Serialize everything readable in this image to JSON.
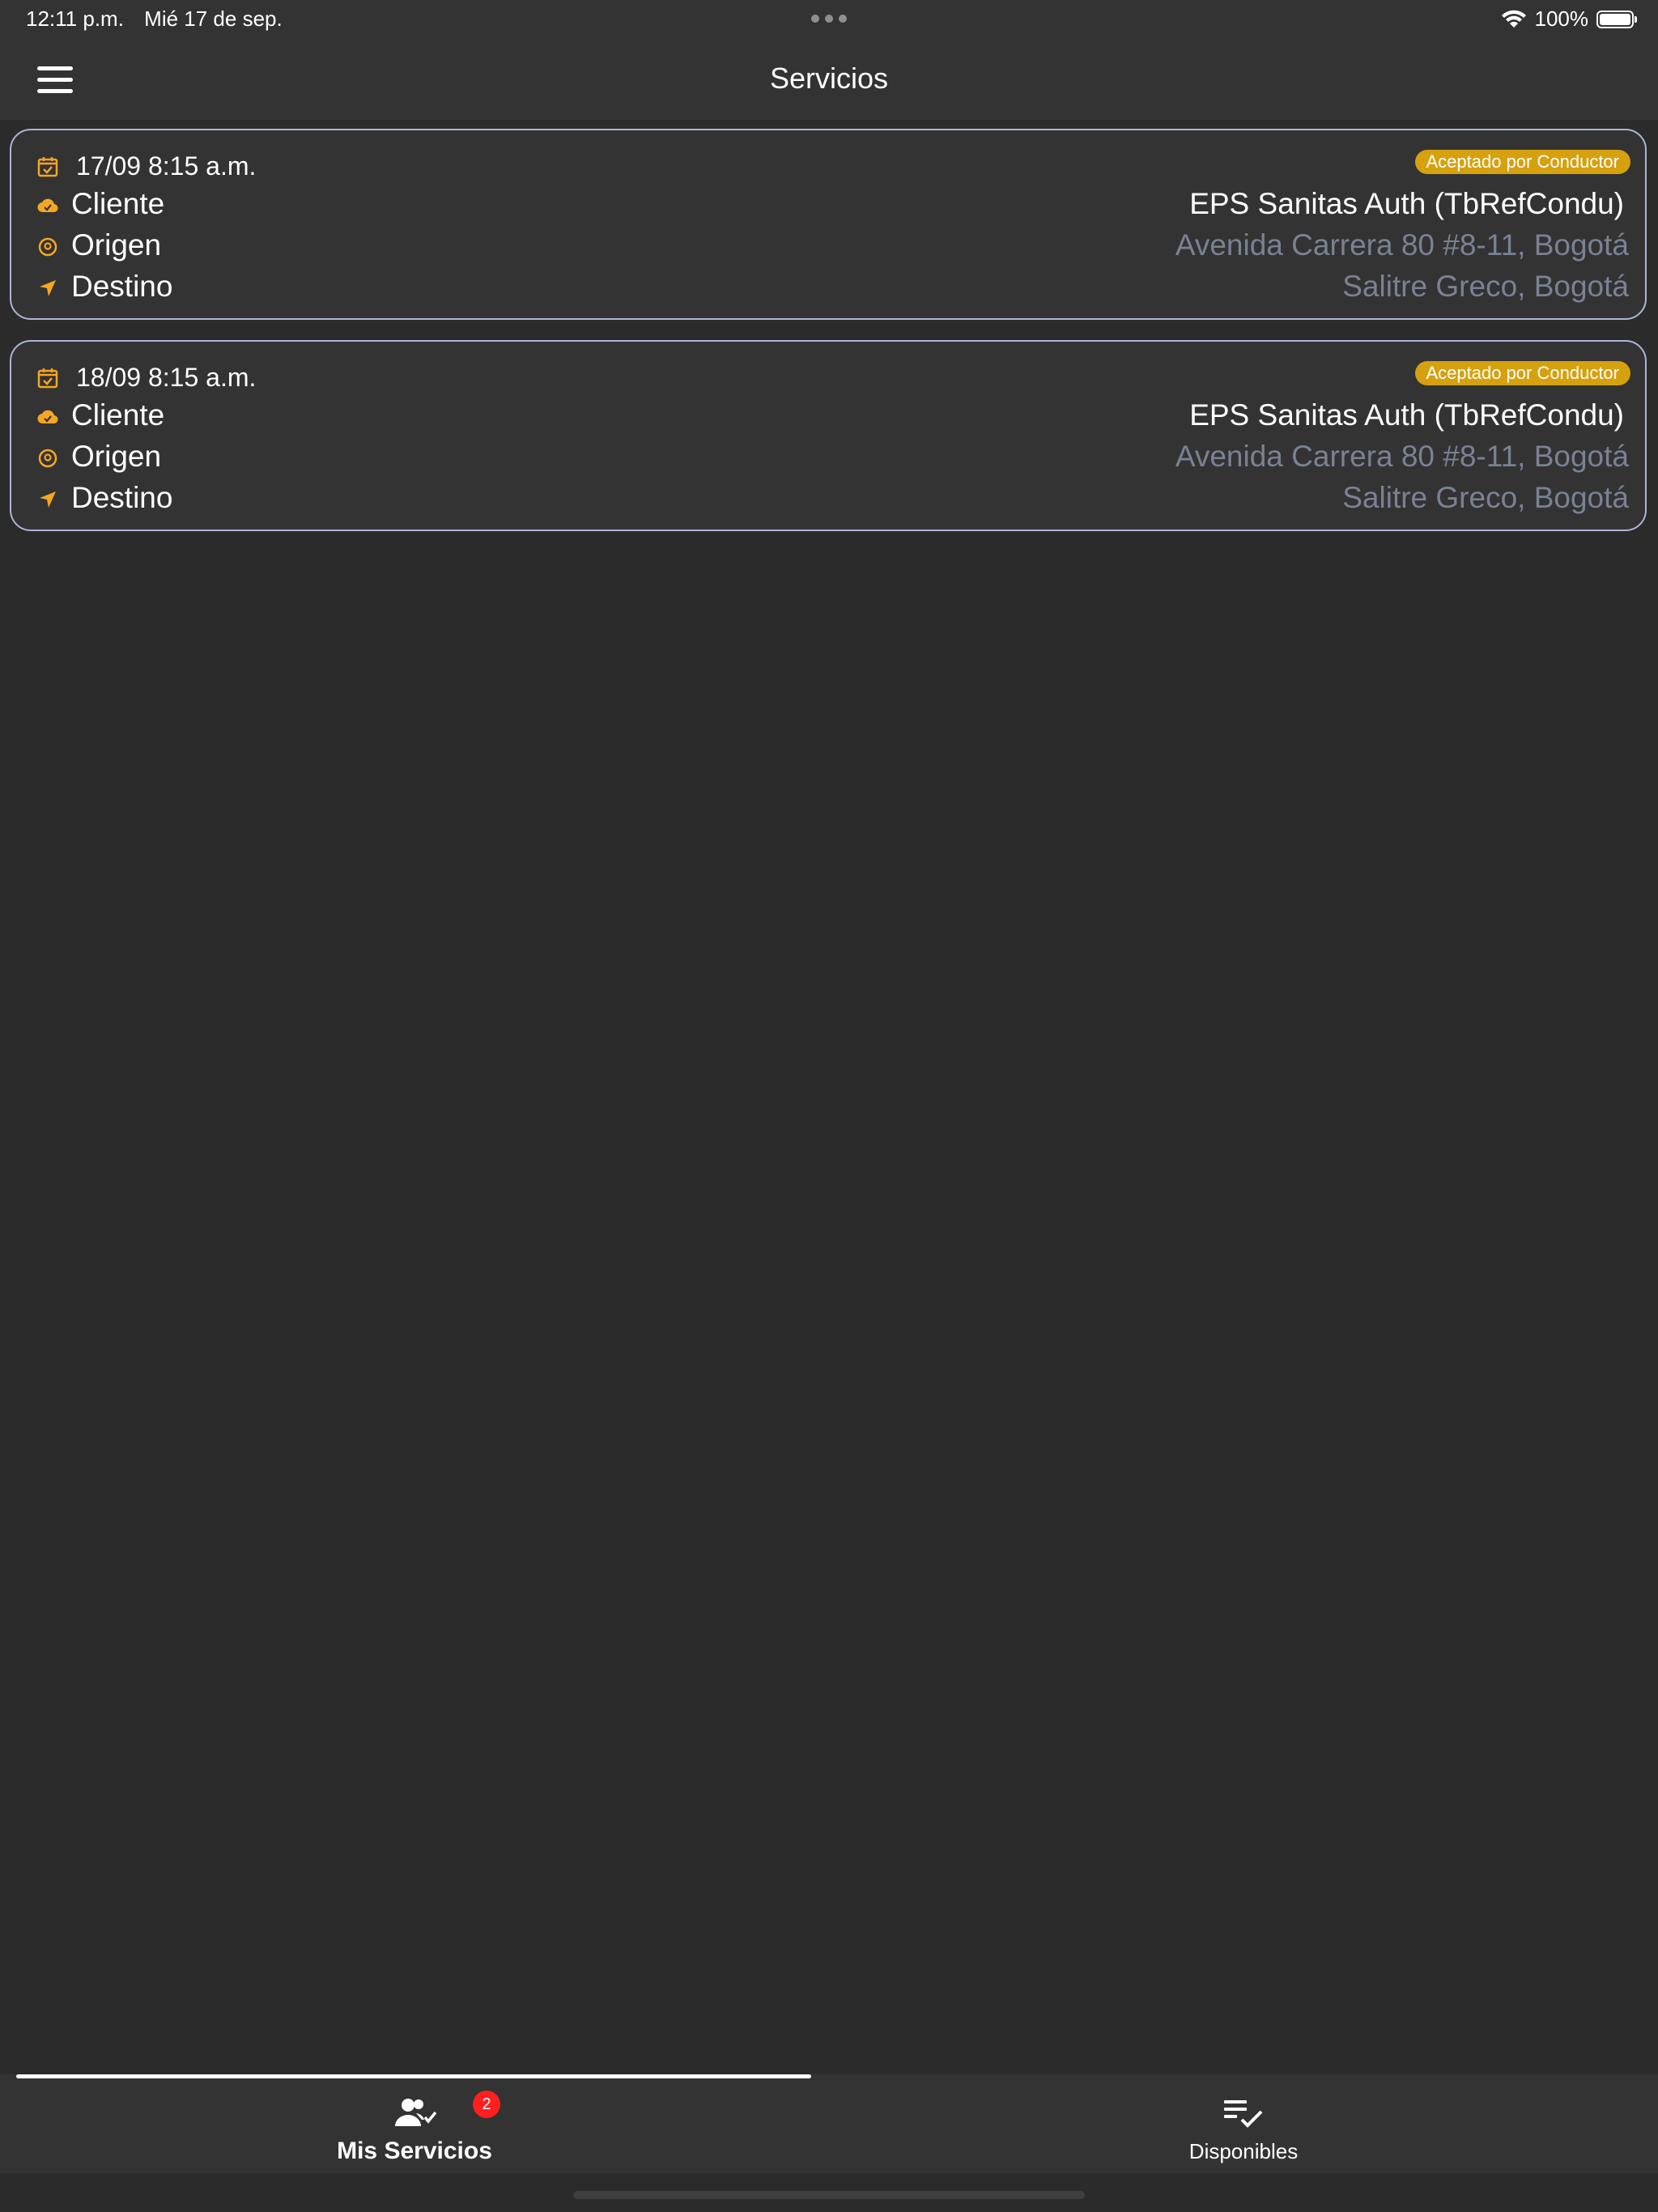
{
  "status_bar": {
    "time": "12:11 p.m.",
    "date": "Mié 17 de sep.",
    "battery": "100%",
    "icons": [
      "wifi-icon",
      "battery-icon"
    ]
  },
  "header": {
    "title": "Servicios",
    "menu_icon": "hamburger-menu-icon"
  },
  "services": [
    {
      "date": "17/09 8:15 a.m.",
      "status": "Aceptado por Conductor",
      "client_label": "Cliente",
      "client": "EPS Sanitas Auth (TbRefCondu)",
      "origin_label": "Origen",
      "origin": "Avenida Carrera 80 #8-11, Bogotá",
      "destination_label": "Destino",
      "destination": "Salitre Greco, Bogotá"
    },
    {
      "date": "18/09 8:15 a.m.",
      "status": "Aceptado por Conductor",
      "client_label": "Cliente",
      "client": "EPS Sanitas Auth (TbRefCondu)",
      "origin_label": "Origen",
      "origin": "Avenida Carrera 80 #8-11, Bogotá",
      "destination_label": "Destino",
      "destination": "Salitre Greco, Bogotá"
    }
  ],
  "tabs": [
    {
      "label": "Mis Servicios",
      "icon": "users-check-icon",
      "badge": "2",
      "active": true
    },
    {
      "label": "Disponibles",
      "icon": "list-check-icon",
      "active": false
    }
  ],
  "colors": {
    "background": "#2b2b2b",
    "surface": "#333333",
    "accent": "#f5a623",
    "badge": "#d6a10e",
    "card_border": "#aab6d6",
    "muted_text": "#7a8194",
    "notification": "#ff1f1f"
  }
}
